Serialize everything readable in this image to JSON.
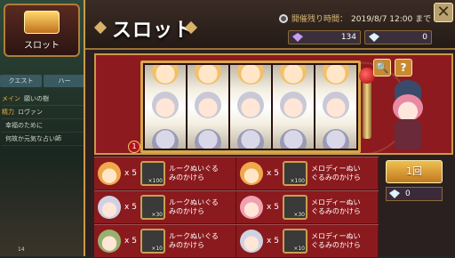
{
  "side": {
    "badge_label": "スロット",
    "tabs": [
      "クエスト",
      "ハー"
    ],
    "lines": [
      {
        "k": "メイン",
        "v": "願いの樹"
      },
      {
        "k": "精力",
        "v": "ロヴァン"
      },
      {
        "k": "",
        "v": "幸福のために"
      },
      {
        "k": "",
        "v": "何故か元気な占い師"
      }
    ],
    "footer_number": "14"
  },
  "header": {
    "title": "スロット",
    "timer_label": "開催残り時間：",
    "timer_value": "2019/8/7 12:00 まで",
    "close_glyph": "✕"
  },
  "currency": {
    "left_value": "134",
    "left_gem_color": "#c89cf0",
    "right_value": "0",
    "right_gem_color": "#dff2ff"
  },
  "machine": {
    "line_badge": "1",
    "zoom_glyph": "🔍",
    "help_glyph": "?"
  },
  "rewards": [
    [
      {
        "icon": "gold",
        "count": "5",
        "item_count": "×100",
        "item_name": "ルークぬいぐるみのかけら"
      },
      {
        "icon": "gold",
        "count": "5",
        "item_count": "×100",
        "item_name": "メロディーぬいぐるみのかけら"
      }
    ],
    [
      {
        "icon": "silv",
        "count": "5",
        "item_count": "×30",
        "item_name": "ルークぬいぐるみのかけら"
      },
      {
        "icon": "pnk",
        "count": "5",
        "item_count": "×30",
        "item_name": "メロディーぬいぐるみのかけら"
      }
    ],
    [
      {
        "icon": "gr",
        "count": "5",
        "item_count": "×10",
        "item_name": "ルークぬいぐるみのかけら"
      },
      {
        "icon": "silv",
        "count": "5",
        "item_count": "×10",
        "item_name": "メロディーぬいぐるみのかけら"
      }
    ]
  ],
  "spin": {
    "button_label": "1回",
    "cost_value": "0"
  }
}
